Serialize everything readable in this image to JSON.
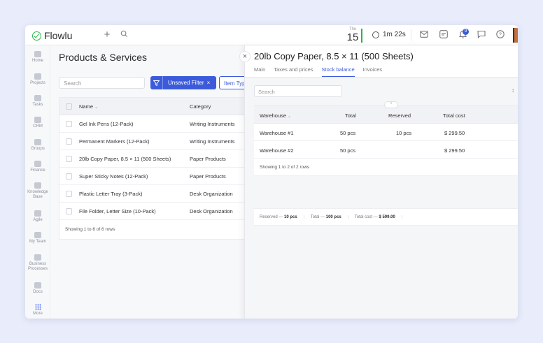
{
  "app": {
    "name": "Flowlu"
  },
  "topbar": {
    "date_dow": "Thu",
    "date_day": "15",
    "timer": "1m 22s",
    "notification_count": "9"
  },
  "sidebar": {
    "items": [
      {
        "label": "Home"
      },
      {
        "label": "Projects"
      },
      {
        "label": "Tasks"
      },
      {
        "label": "CRM"
      },
      {
        "label": "Groups"
      },
      {
        "label": "Finance"
      },
      {
        "label": "Knowledge Base"
      },
      {
        "label": "Agile"
      },
      {
        "label": "My Team"
      },
      {
        "label": "Business Processes"
      },
      {
        "label": "Docs"
      },
      {
        "label": "More"
      }
    ]
  },
  "products": {
    "title": "Products & Services",
    "search_placeholder": "Search",
    "filter_label": "Unsaved Filter",
    "filter_clear": "×",
    "item_type_label": "Item Typ",
    "columns": {
      "name": "Name",
      "category": "Category"
    },
    "rows": [
      {
        "name": "Gel Ink Pens (12-Pack)",
        "category": "Writing Instruments"
      },
      {
        "name": "Permanent Markers (12-Pack)",
        "category": "Writing Instruments"
      },
      {
        "name": "20lb Copy Paper, 8.5 × 11 (500 Sheets)",
        "category": "Paper Products"
      },
      {
        "name": "Super Sticky Notes (12-Pack)",
        "category": "Paper Products"
      },
      {
        "name": "Plastic Letter Tray (3-Pack)",
        "category": "Desk Organization"
      },
      {
        "name": "File Folder, Letter Size (10-Pack)",
        "category": "Desk Organization"
      }
    ],
    "footer": "Showing 1 to 6 of 6 rows"
  },
  "detail": {
    "title": "20lb Copy Paper, 8.5 × 11 (500 Sheets)",
    "tabs": [
      "Main",
      "Taxes and prices",
      "Stock balance",
      "Invoices"
    ],
    "active_tab": "Stock balance",
    "search_placeholder": "Search",
    "columns": {
      "warehouse": "Warehouse",
      "total": "Total",
      "reserved": "Reserved",
      "total_cost": "Total cost"
    },
    "rows": [
      {
        "warehouse": "Warehouse #1",
        "total": "50 pcs",
        "reserved": "10 pcs",
        "total_cost": "$ 299.50"
      },
      {
        "warehouse": "Warehouse #2",
        "total": "50 pcs",
        "reserved": "",
        "total_cost": "$ 299.50"
      }
    ],
    "footer": "Showing 1 to 2 of 2 rows",
    "summary": {
      "reserved_label": "Reserved —",
      "reserved_value": "10 pcs",
      "total_label": "Total —",
      "total_value": "100 pcs",
      "total_cost_label": "Total cost —",
      "total_cost_value": "$ 599.00"
    }
  },
  "colors": {
    "accent": "#3b5bdb",
    "brand": "#2bb24c"
  }
}
